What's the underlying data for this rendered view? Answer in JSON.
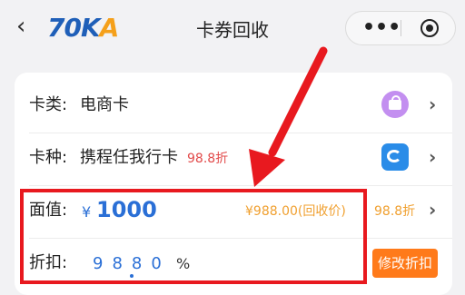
{
  "nav": {
    "back_glyph": "‹",
    "logo_main": "70K",
    "logo_accent": "A",
    "title": "卡券回收",
    "more_glyph": "•••"
  },
  "card": {
    "category": {
      "label": "卡类:",
      "value": "电商卡",
      "icon": "shopping-bag-icon"
    },
    "type": {
      "label": "卡种:",
      "value": "携程任我行卡",
      "discount": "98.8折",
      "icon": "ctrip-dolphin-icon"
    },
    "face": {
      "label": "面值:",
      "currency": "¥",
      "amount": "1000",
      "recycle_price": "¥988.00(回收价)",
      "ratio": "98.8折"
    },
    "rate": {
      "label": "折扣:",
      "digits": "9880",
      "percent": "%",
      "button": "修改折扣"
    }
  },
  "colors": {
    "highlight": "#e8191f",
    "accent_blue": "#2a6fd6",
    "accent_orange": "#ff7a1a"
  }
}
